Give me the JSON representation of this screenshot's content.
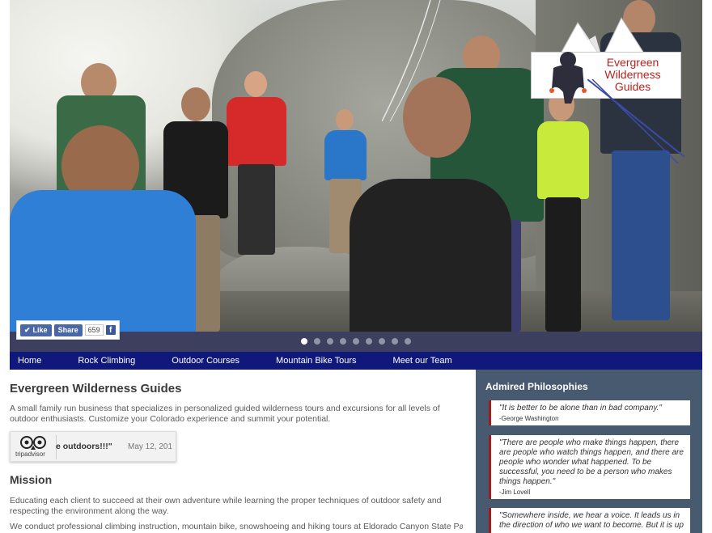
{
  "brand": {
    "logo_text": "Evergreen Wilderness Guides",
    "logo_color": "#b8231f"
  },
  "social": {
    "like_label": "Like",
    "share_label": "Share",
    "count": "659",
    "fb_icon_letter": "f"
  },
  "slider": {
    "dot_count": 9,
    "active_index": 0
  },
  "nav": {
    "items": [
      {
        "label": "Home"
      },
      {
        "label": "Rock Climbing"
      },
      {
        "label": "Outdoor Courses"
      },
      {
        "label": "Mountain Bike Tours"
      },
      {
        "label": "Meet our Team"
      }
    ],
    "bg_color": "#10197b"
  },
  "main": {
    "title": "Evergreen Wilderness Guides",
    "intro": "A small family run business that specializes in personalized guided wilderness tours and excursions for all levels of outdoor enthusiasts. Customize your Colorado experience and summit your potential.",
    "tripadvisor": {
      "brand": "tripadvisor",
      "quote_snippet": "e outdoors!!!\"",
      "date": "May 12, 201"
    },
    "mission_title": "Mission",
    "mission_p1": "Educating each client to succeed at their own adventure while learning the proper techniques of outdoor safety and respecting the environment along the way.",
    "mission_p2": "We conduct professional climbing instruction, mountain bike, snowshoeing and hiking tours at Eldorado Canyon State Park"
  },
  "sidebar": {
    "title": "Admired Philosophies",
    "bg_color": "#485a6f",
    "quotes": [
      {
        "text": "\"It is better to be alone than in bad company.\"",
        "author": "-George Washington"
      },
      {
        "text": "\"There are people who make things happen, there are people who watch things happen, and there are people who wonder what happened. To be successful, you need to be a person who makes things happen.\"",
        "author": "-Jim Lovell"
      },
      {
        "text": "\"Somewhere inside, we hear a voice. It leads us in the direction of who we want to become. But it is up",
        "author": ""
      }
    ]
  }
}
